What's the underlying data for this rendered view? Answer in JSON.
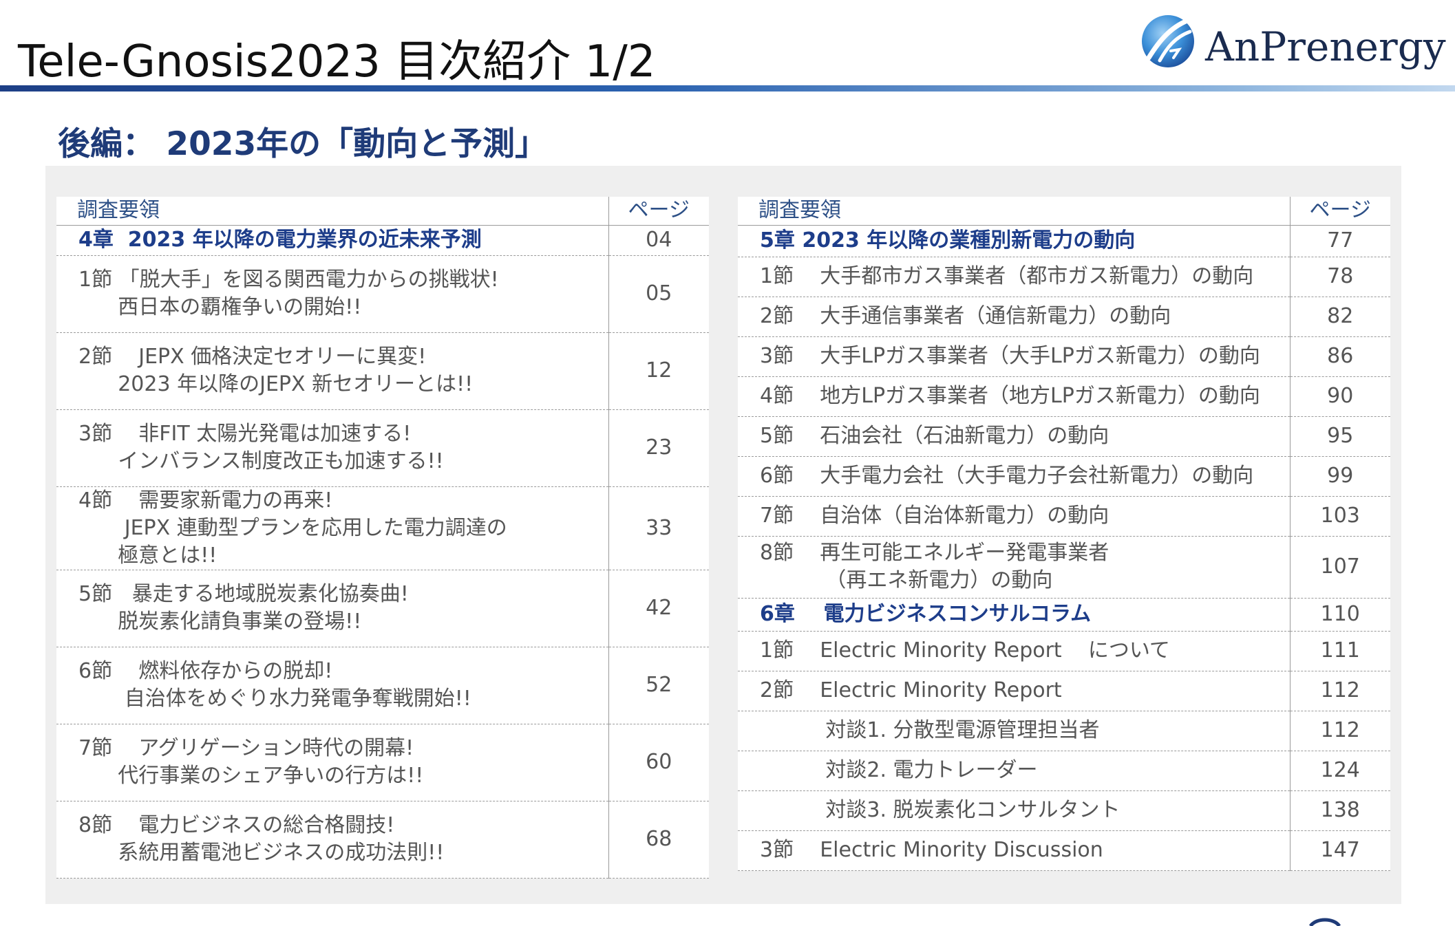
{
  "header": {
    "title": "Tele-Gnosis2023 目次紹介 1/2",
    "logo_text": "AnPrenergy",
    "subtitle": "後編： 2023年の「動向と予測」"
  },
  "colors": {
    "title_rule_start": "#1d3f86",
    "title_rule_end": "#c2d8ef",
    "chapter_text": "#1d3d8a",
    "subtitle_text": "#1f3b78",
    "panel_bg": "#efefef"
  },
  "left_table": {
    "header": {
      "label": "調査要領",
      "page": "ページ"
    },
    "rows": [
      {
        "lines": [
          "4章  2023 年以降の電力業界の近未来予測"
        ],
        "page": "04",
        "chapter": true
      },
      {
        "lines": [
          "1節 「脱大手」を図る関西電力からの挑戦状!",
          "      西日本の覇権争いの開始!!"
        ],
        "page": "05"
      },
      {
        "lines": [
          "2節    JEPX 価格決定セオリーに異変!",
          "      2023 年以降のJEPX 新セオリーとは!!"
        ],
        "page": "12"
      },
      {
        "lines": [
          "3節    非FIT 太陽光発電は加速する!",
          "      インバランス制度改正も加速する!!"
        ],
        "page": "23"
      },
      {
        "lines": [
          "4節    需要家新電力の再来!",
          "       JEPX 連動型プランを応用した電力調達の",
          "      極意とは!!"
        ],
        "page": "33"
      },
      {
        "lines": [
          "5節   暴走する地域脱炭素化協奏曲!",
          "      脱炭素化請負事業の登場!!"
        ],
        "page": "42"
      },
      {
        "lines": [
          "6節    燃料依存からの脱却!",
          "       自治体をめぐり水力発電争奪戦開始!!"
        ],
        "page": "52"
      },
      {
        "lines": [
          "7節    アグリゲーション時代の開幕!",
          "      代行事業のシェア争いの行方は!!"
        ],
        "page": "60"
      },
      {
        "lines": [
          "8節    電力ビジネスの総合格闘技!",
          "      系統用蓄電池ビジネスの成功法則!!"
        ],
        "page": "68"
      }
    ]
  },
  "right_table": {
    "header": {
      "label": "調査要領",
      "page": "ページ"
    },
    "rows": [
      {
        "lines": [
          "5章 2023 年以降の業種別新電力の動向"
        ],
        "page": "77",
        "chapter": true
      },
      {
        "lines": [
          "1節    大手都市ガス事業者（都市ガス新電力）の動向"
        ],
        "page": "78"
      },
      {
        "lines": [
          "2節    大手通信事業者（通信新電力）の動向"
        ],
        "page": "82"
      },
      {
        "lines": [
          "3節    大手LPガス事業者（大手LPガス新電力）の動向"
        ],
        "page": "86"
      },
      {
        "lines": [
          "4節    地方LPガス事業者（地方LPガス新電力）の動向"
        ],
        "page": "90"
      },
      {
        "lines": [
          "5節    石油会社（石油新電力）の動向"
        ],
        "page": "95"
      },
      {
        "lines": [
          "6節    大手電力会社（大手電力子会社新電力）の動向"
        ],
        "page": "99"
      },
      {
        "lines": [
          "7節    自治体（自治体新電力）の動向"
        ],
        "page": "103"
      },
      {
        "lines": [
          "8節    再生可能エネルギー発電事業者",
          "          （再エネ新電力）の動向"
        ],
        "page": "107"
      },
      {
        "lines": [
          "6章    電力ビジネスコンサルコラム"
        ],
        "page": "110",
        "chapter": true
      },
      {
        "lines": [
          "1節    Electric Minority Report    について"
        ],
        "page": "111"
      },
      {
        "lines": [
          "2節    Electric Minority Report"
        ],
        "page": "112"
      },
      {
        "lines": [
          "          対談1. 分散型電源管理担当者"
        ],
        "page": "112"
      },
      {
        "lines": [
          "          対談2. 電力トレーダー"
        ],
        "page": "124"
      },
      {
        "lines": [
          "          対談3. 脱炭素化コンサルタント"
        ],
        "page": "138"
      },
      {
        "lines": [
          "3節    Electric Minority Discussion"
        ],
        "page": "147"
      }
    ]
  }
}
